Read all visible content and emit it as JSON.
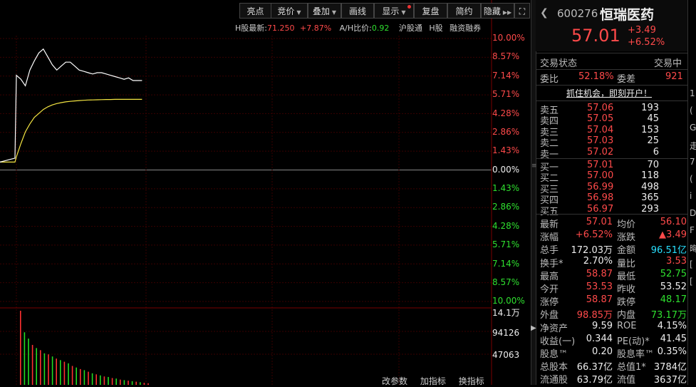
{
  "toolbar": {
    "buttons": [
      "亮点",
      "竞价",
      "叠加",
      "画线",
      "显示",
      "复盘",
      "简约",
      "隐藏"
    ],
    "fullscreen": "⛶"
  },
  "hinfo": {
    "h_label": "H股最新:",
    "h_price": "71.250",
    "h_change": "+7.87%",
    "ah_label": "A/H比价:",
    "ah_value": "0.92",
    "hgt": "沪股通",
    "hshare": "H股",
    "margin": "融资融券"
  },
  "axis": {
    "pct_up": [
      "10.00%",
      "8.57%",
      "7.14%",
      "5.71%",
      "4.28%",
      "2.86%",
      "1.43%"
    ],
    "zero": "0.00%",
    "pct_down": [
      "1.43%",
      "2.86%",
      "4.28%",
      "5.71%",
      "7.14%",
      "8.57%",
      "10.00%"
    ],
    "vol": [
      "14.1万",
      "94126",
      "47063"
    ]
  },
  "bottom_tabs": [
    "改参数",
    "加指标",
    "换指标"
  ],
  "stock": {
    "code": "600276",
    "name": "恒瑞医药",
    "price": "57.01",
    "change": "+3.49",
    "change_pct": "+6.52%"
  },
  "status": {
    "label": "交易状态",
    "value": "交易中",
    "wb_label": "委比",
    "wb_value": "52.18%",
    "wc_label": "委差",
    "wc_value": "921",
    "promo": "抓住机会，即刻开户！"
  },
  "orderbook": {
    "sell": [
      {
        "label": "卖五",
        "price": "57.06",
        "vol": "193"
      },
      {
        "label": "卖四",
        "price": "57.05",
        "vol": "45"
      },
      {
        "label": "卖三",
        "price": "57.04",
        "vol": "153"
      },
      {
        "label": "卖二",
        "price": "57.03",
        "vol": "25"
      },
      {
        "label": "卖一",
        "price": "57.02",
        "vol": "6"
      }
    ],
    "buy": [
      {
        "label": "买一",
        "price": "57.01",
        "vol": "70"
      },
      {
        "label": "买二",
        "price": "57.00",
        "vol": "118"
      },
      {
        "label": "买三",
        "price": "56.99",
        "vol": "498"
      },
      {
        "label": "买四",
        "price": "56.98",
        "vol": "365"
      },
      {
        "label": "买五",
        "price": "56.97",
        "vol": "293"
      }
    ]
  },
  "stats": [
    {
      "l1": "最新",
      "v1": "57.01",
      "c1": "red",
      "l2": "均价",
      "v2": "56.10",
      "c2": "red"
    },
    {
      "l1": "涨幅",
      "v1": "+6.52%",
      "c1": "red",
      "l2": "涨跌",
      "v2": "▲3.49",
      "c2": "red"
    },
    {
      "l1": "总手",
      "v1": "172.03万",
      "c1": "white",
      "l2": "金额",
      "v2": "96.51亿",
      "c2": "cyan"
    },
    {
      "l1": "换手*",
      "v1": "2.70%",
      "c1": "white",
      "l2": "量比",
      "v2": "3.53",
      "c2": "red"
    },
    {
      "l1": "最高",
      "v1": "58.87",
      "c1": "red",
      "l2": "最低",
      "v2": "52.75",
      "c2": "green"
    },
    {
      "l1": "今开",
      "v1": "53.53",
      "c1": "red",
      "l2": "昨收",
      "v2": "53.52",
      "c2": "white"
    },
    {
      "l1": "涨停",
      "v1": "58.87",
      "c1": "red",
      "l2": "跌停",
      "v2": "48.17",
      "c2": "green"
    },
    {
      "l1": "外盘",
      "v1": "98.85万",
      "c1": "red",
      "l2": "内盘",
      "v2": "73.17万",
      "c2": "green"
    },
    {
      "l1": "净资产",
      "v1": "9.59",
      "c1": "white",
      "l2": "ROE",
      "v2": "4.15%",
      "c2": "white"
    },
    {
      "l1": "收益(一)",
      "v1": "0.344",
      "c1": "white",
      "l2": "PE(动)*",
      "v2": "41.45",
      "c2": "white"
    },
    {
      "l1": "股息™",
      "v1": "0.20",
      "c1": "white",
      "l2": "股息率™",
      "v2": "0.35%",
      "c2": "white"
    },
    {
      "l1": "总股本",
      "v1": "66.37亿",
      "c1": "white",
      "l2": "总值1*",
      "v2": "3784亿",
      "c2": "white"
    },
    {
      "l1": "流通股",
      "v1": "63.79亿",
      "c1": "white",
      "l2": "流值",
      "v2": "3637亿",
      "c2": "white"
    }
  ],
  "edge_chars": [
    "1",
    "(",
    "G",
    "走",
    "7",
    "(",
    "i",
    "D",
    "F",
    "晦",
    "[",
    "["
  ],
  "chart_data": {
    "type": "line",
    "prev_close": 53.52,
    "ylim_pct": [
      -10.0,
      10.0
    ],
    "series": [],
    "price_pct": [
      0.6,
      0.7,
      0.8,
      0.9,
      7.2,
      6.9,
      6.4,
      7.6,
      8.3,
      8.9,
      9.2,
      8.6,
      8.0,
      7.6,
      7.9,
      8.2,
      8.2,
      7.9,
      7.6,
      7.5,
      7.4,
      7.3,
      7.4,
      7.4,
      7.3,
      7.2,
      7.1,
      7.0,
      6.9,
      7.0,
      6.8,
      6.8,
      6.8
    ],
    "avg_pct": [
      0.6,
      0.6,
      0.6,
      0.6,
      1.0,
      2.0,
      2.9,
      3.5,
      4.0,
      4.3,
      4.6,
      4.8,
      4.95,
      5.05,
      5.12,
      5.18,
      5.22,
      5.25,
      5.28,
      5.3,
      5.32,
      5.33,
      5.34,
      5.35,
      5.36,
      5.36,
      5.37,
      5.37,
      5.37,
      5.37,
      5.37,
      5.37,
      5.37
    ],
    "volume": [
      141000,
      100000,
      88000,
      76000,
      70000,
      66000,
      60000,
      58000,
      54000,
      50000,
      47063,
      44000,
      41000,
      36000,
      33000,
      30000,
      28000,
      25000,
      22000,
      20000,
      18000,
      16000,
      15000,
      13000,
      12000,
      10000,
      9000,
      8000,
      7000,
      6000,
      5000,
      4000,
      3000
    ],
    "volume_colors": [
      "red",
      "green",
      "green",
      "red",
      "green",
      "red",
      "green",
      "red",
      "green",
      "red",
      "green",
      "red",
      "green",
      "red",
      "green",
      "red",
      "green",
      "red",
      "green",
      "red",
      "green",
      "red",
      "green",
      "red",
      "green",
      "red",
      "green",
      "red",
      "green",
      "red",
      "green",
      "red",
      "red"
    ],
    "vol_ticks": [
      "14.1万",
      "94126",
      "47063"
    ]
  }
}
